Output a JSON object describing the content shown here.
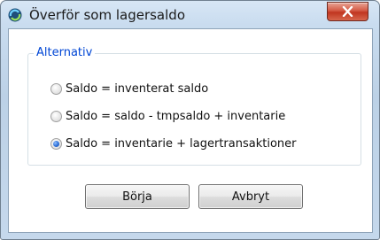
{
  "window": {
    "title": "Överför som lagersaldo",
    "icon": "app-refresh-icon",
    "close_icon": "close-icon"
  },
  "group": {
    "legend": "Alternativ",
    "options": [
      {
        "label": "Saldo = inventerat saldo",
        "checked": false
      },
      {
        "label": "Saldo = saldo - tmpsaldo + inventarie",
        "checked": false
      },
      {
        "label": "Saldo = inventarie + lagertransaktioner",
        "checked": true
      }
    ]
  },
  "buttons": {
    "start": "Börja",
    "cancel": "Avbryt"
  },
  "colors": {
    "legend": "#0046d5",
    "close_button": "#c0351f"
  }
}
